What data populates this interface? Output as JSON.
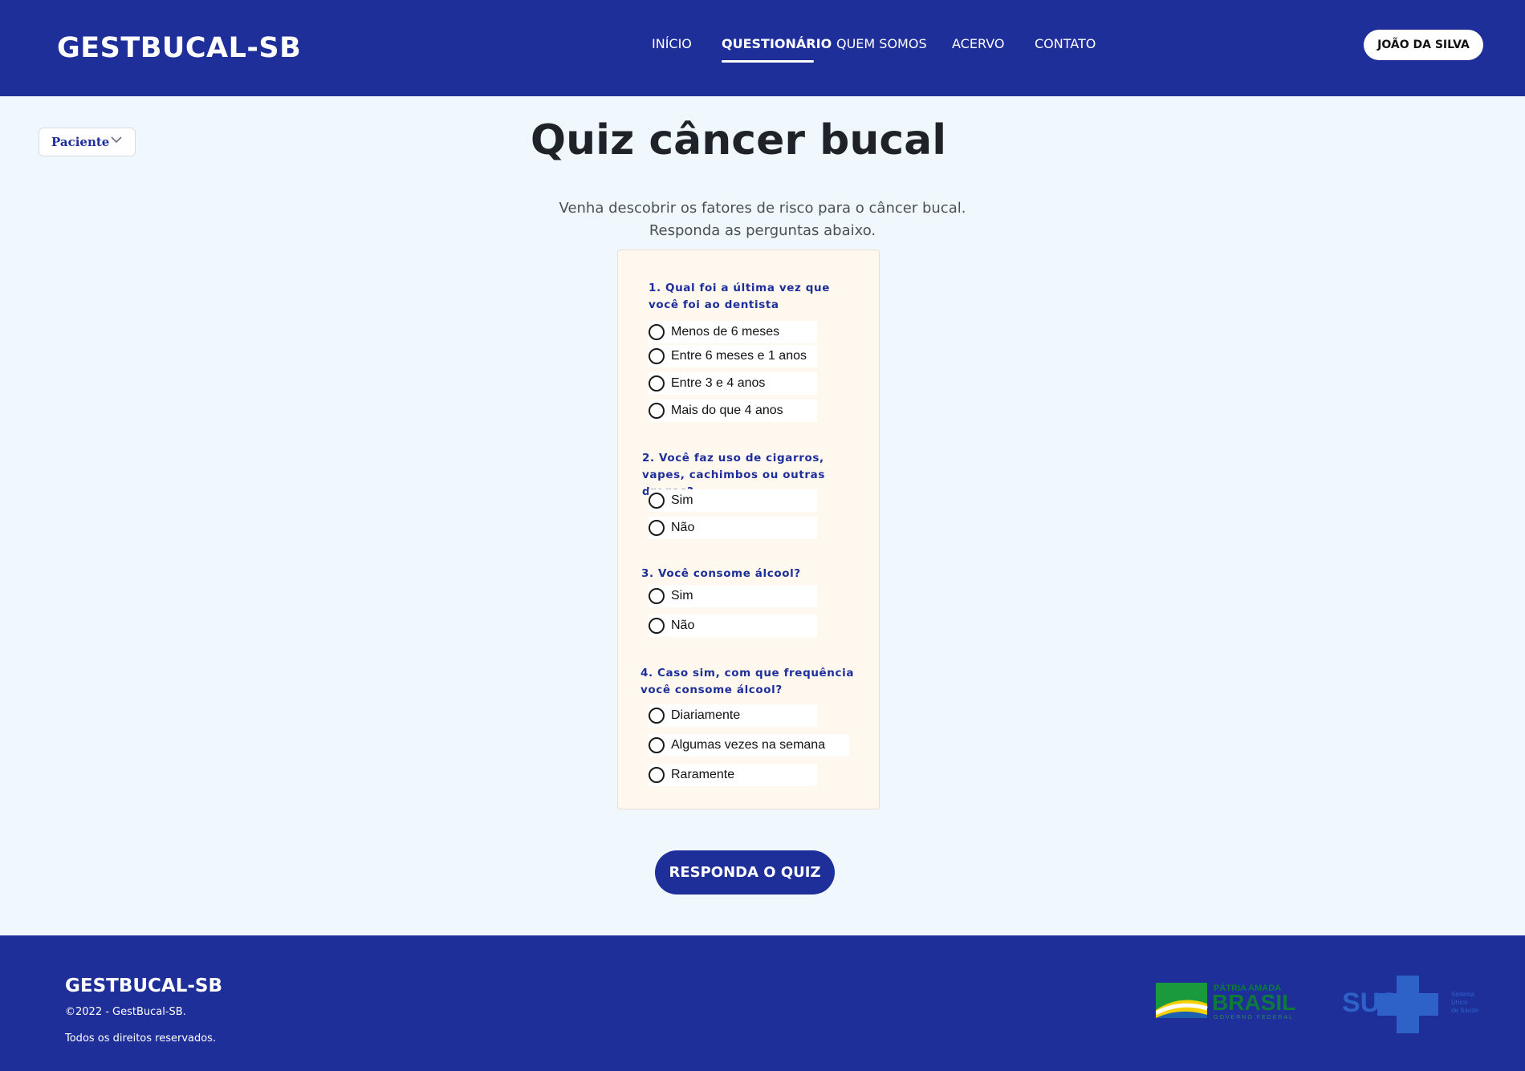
{
  "header": {
    "brand": "GESTBUCAL-SB",
    "nav": [
      {
        "label": "INÍCIO",
        "active": false
      },
      {
        "label": "QUESTIONÁRIO",
        "active": true
      },
      {
        "label": "QUEM SOMOS",
        "active": false
      },
      {
        "label": "ACERVO",
        "active": false
      },
      {
        "label": "CONTATO",
        "active": false
      }
    ],
    "user_button": "JOÃO DA SILVA"
  },
  "role_select": {
    "value": "Paciente"
  },
  "main": {
    "title": "Quiz câncer bucal",
    "subtitle": "Venha descobrir os fatores de risco para o câncer bucal. Responda as perguntas abaixo."
  },
  "quiz": {
    "questions": [
      {
        "title": "1. Qual foi a última vez que você foi ao dentista",
        "options": [
          "Menos de 6 meses",
          "Entre 6 meses e 1 anos",
          "Entre 3 e 4 anos",
          "Mais do que 4 anos"
        ]
      },
      {
        "title": "2. Você faz uso de cigarros, vapes, cachimbos ou outras drogas?",
        "options": [
          "Sim",
          "Não"
        ]
      },
      {
        "title": "3. Você consome álcool?",
        "options": [
          "Sim",
          "Não"
        ]
      },
      {
        "title": "4. Caso sim, com que frequência você consome álcool?",
        "options": [
          "Diariamente",
          "Algumas vezes na semana",
          "Raramente"
        ]
      }
    ],
    "submit_label": "RESPONDA O QUIZ"
  },
  "footer": {
    "brand": "GESTBUCAL-SB",
    "copyright": "©2022 - GestBucal-SB.",
    "rights": "Todos os direitos reservados.",
    "gov_logo_text": [
      "PÁTRIA AMADA",
      "BRASIL",
      "GOVERNO FEDERAL"
    ],
    "sus_logo_text": [
      "SUS",
      "Sistema",
      "Único",
      "de Saúde"
    ]
  },
  "colors": {
    "primary": "#1e2f9a",
    "background": "#f0f8fd",
    "card": "#fff8ee"
  },
  "icons": {
    "role_select": "chevron-down-icon",
    "option": "radio-icon"
  }
}
